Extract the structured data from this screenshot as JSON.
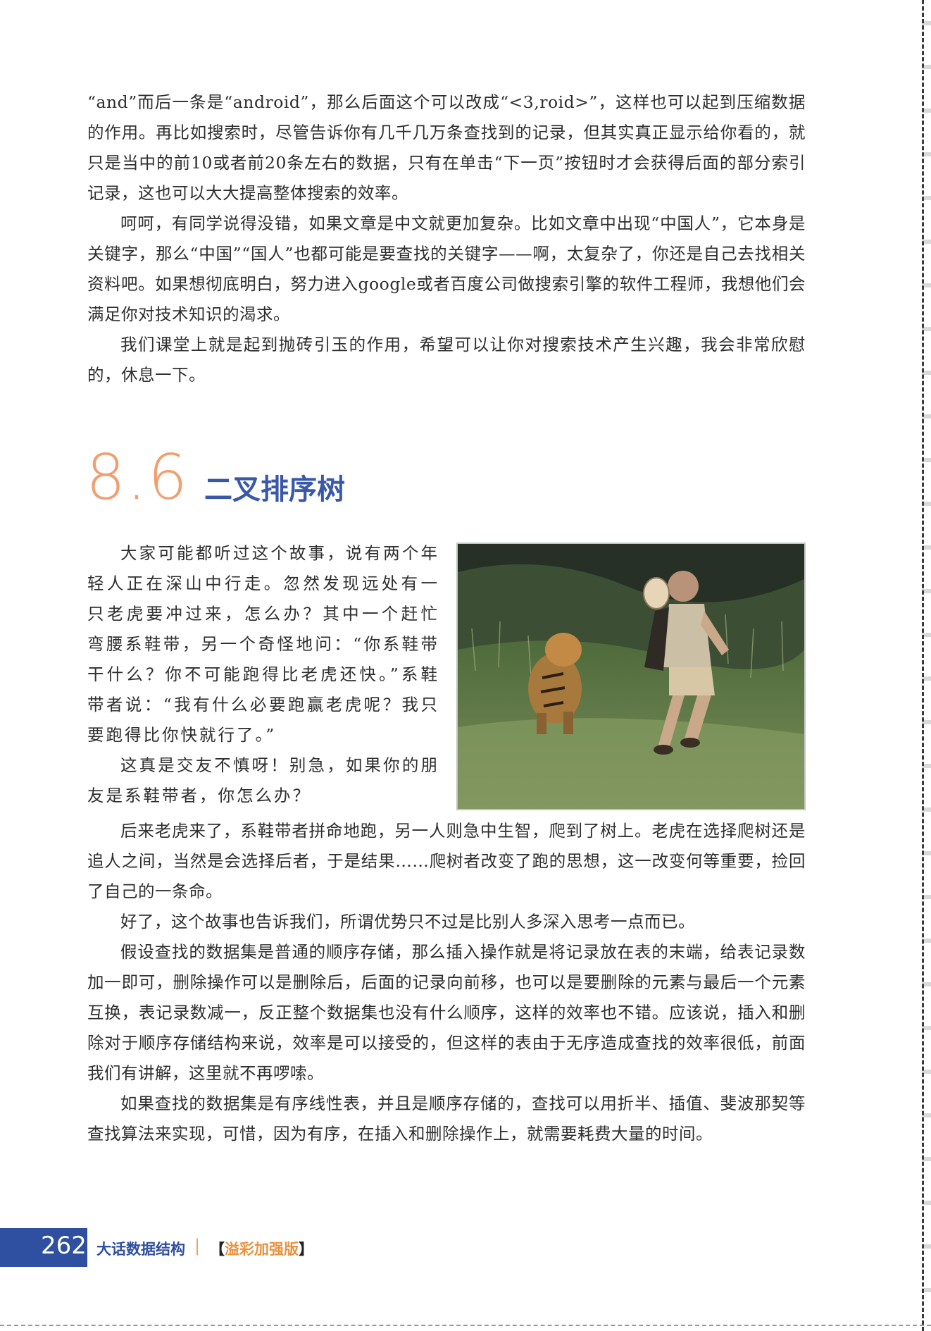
{
  "top_paragraphs": [
    {
      "text": "“and”而后一条是“android”，那么后面这个可以改成“<3,roid>”，这样也可以起到压缩数据的作用。再比如搜索时，尽管告诉你有几千几万条查找到的记录，但其实真正显示给你看的，就只是当中的前10或者前20条左右的数据，只有在单击“下一页”按钮时才会获得后面的部分索引记录，这也可以大大提高整体搜索的效率。"
    },
    {
      "text": "呵呵，有同学说得没错，如果文章是中文就更加复杂。比如文章中出现“中国人”，它本身是关键字，那么“中国”“国人”也都可能是要查找的关键字——啊，太复杂了，你还是自己去找相关资料吧。如果想彻底明白，努力进入google或者百度公司做搜索引擎的软件工程师，我想他们会满足你对技术知识的渴求。"
    },
    {
      "text": "我们课堂上就是起到抛砖引玉的作用，希望可以让你对搜索技术产生兴趣，我会非常欣慰的，休息一下。"
    }
  ],
  "section": {
    "number": "8.6",
    "title": "二叉排序树"
  },
  "story_paragraphs": [
    {
      "text": "大家可能都听过这个故事，说有两个年轻人正在深山中行走。忽然发现远处有一只老虎要冲过来，怎么办？其中一个赶忙弯腰系鞋带，另一个奇怪地问：“你系鞋带干什么？你不可能跑得比老虎还快。”系鞋带者说：“我有什么必要跑赢老虎呢？我只要跑得比你快就行了。”"
    },
    {
      "text": "这真是交友不慎呀！别急，如果你的朋友是系鞋带者，你怎么办？"
    }
  ],
  "lower_paragraphs": [
    {
      "text": "后来老虎来了，系鞋带者拼命地跑，另一人则急中生智，爬到了树上。老虎在选择爬树还是追人之间，当然是会选择后者，于是结果……爬树者改变了跑的思想，这一改变何等重要，捡回了自己的一条命。"
    },
    {
      "text": "好了，这个故事也告诉我们，所谓优势只不过是比别人多深入思考一点而已。"
    },
    {
      "text": "假设查找的数据集是普通的顺序存储，那么插入操作就是将记录放在表的末端，给表记录数加一即可，删除操作可以是删除后，后面的记录向前移，也可以是要删除的元素与最后一个元素互换，表记录数减一，反正整个数据集也没有什么顺序，这样的效率也不错。应该说，插入和删除对于顺序存储结构来说，效率是可以接受的，但这样的表由于无序造成查找的效率很低，前面我们有讲解，这里就不再啰嗦。"
    },
    {
      "text": "如果查找的数据集是有序线性表，并且是顺序存储的，查找可以用折半、插值、斐波那契等查找算法来实现，可惜，因为有序，在插入和删除操作上，就需要耗费大量的时间。"
    }
  ],
  "footer": {
    "page_number": "262",
    "book_title": "大话数据结构",
    "separator": "|",
    "edition_open": "【",
    "edition": "溢彩加强版",
    "edition_close": "】"
  },
  "colors": {
    "section_number": "#f0a070",
    "section_title": "#3a58a8",
    "footer_bar": "#2f4fa0"
  }
}
